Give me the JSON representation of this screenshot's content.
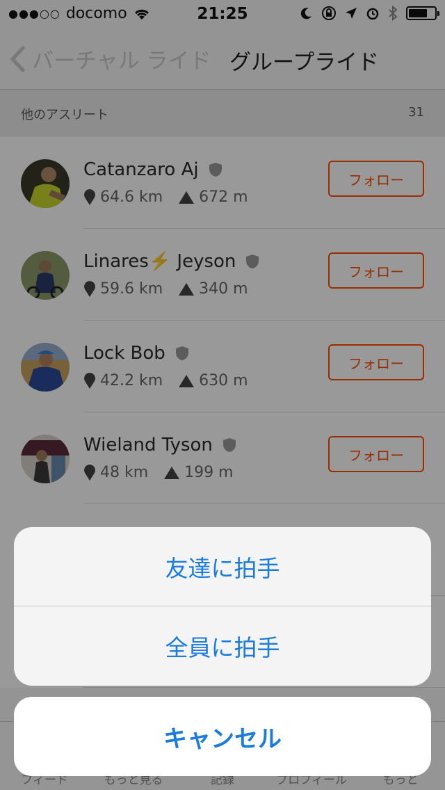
{
  "status_bar": {
    "signal": "●●●○○",
    "carrier": "docomo",
    "time": "21:25",
    "battery_level": 0.75
  },
  "nav": {
    "back_label": "バーチャル ライド",
    "title": "グループライド"
  },
  "section": {
    "label": "他のアスリート",
    "count": "31"
  },
  "athletes": [
    {
      "name": "Catanzaro Aj",
      "distance": "64.6 km",
      "elevation": "672 m",
      "follow_label": "フォロー"
    },
    {
      "name": "Linares⚡️ Jeyson",
      "distance": "59.6 km",
      "elevation": "340 m",
      "follow_label": "フォロー"
    },
    {
      "name": "Lock Bob",
      "distance": "42.2 km",
      "elevation": "630 m",
      "follow_label": "フォロー"
    },
    {
      "name": "Wieland Tyson",
      "distance": "48 km",
      "elevation": "199 m",
      "follow_label": "フォロー"
    }
  ],
  "tabs": [
    "フィード",
    "もっと見る",
    "記録",
    "プロフィール",
    "もっと"
  ],
  "action_sheet": {
    "option1": "友達に拍手",
    "option2": "全員に拍手",
    "cancel": "キャンセル"
  },
  "colors": {
    "accent": "#fc4c02",
    "action_blue": "#1a7ce0"
  }
}
